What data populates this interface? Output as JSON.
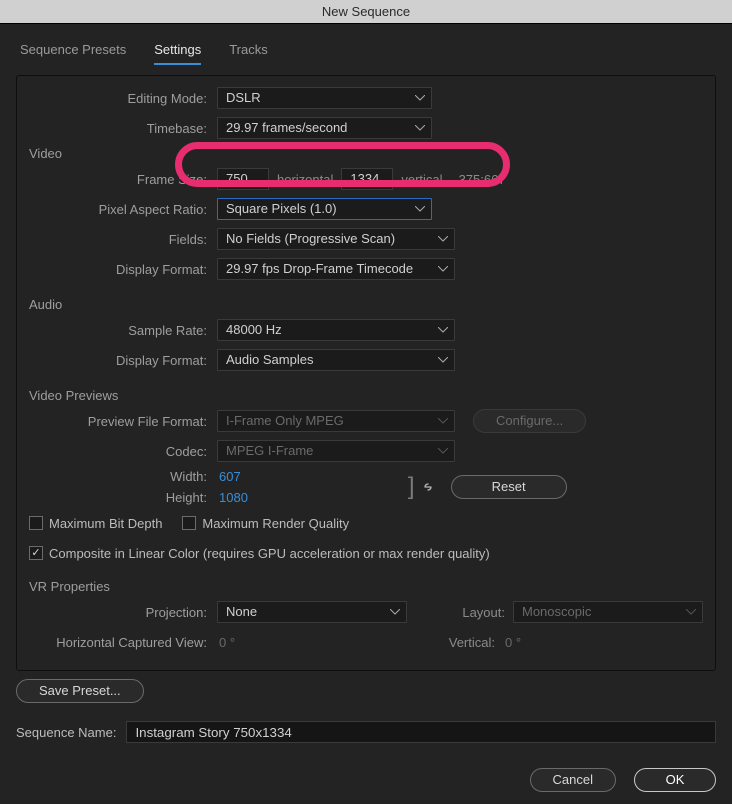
{
  "title": "New Sequence",
  "tabs": {
    "presets": "Sequence Presets",
    "settings": "Settings",
    "tracks": "Tracks"
  },
  "main": {
    "editing_mode_label": "Editing Mode:",
    "editing_mode_value": "DSLR",
    "timebase_label": "Timebase:",
    "timebase_value": "29.97  frames/second"
  },
  "video": {
    "section": "Video",
    "frame_size_label": "Frame Size:",
    "horiz_value": "750",
    "horiz_label": "horizontal",
    "vert_value": "1334",
    "vert_label": "vertical",
    "aspect": "375:667",
    "par_label": "Pixel Aspect Ratio:",
    "par_value": "Square Pixels (1.0)",
    "fields_label": "Fields:",
    "fields_value": "No Fields (Progressive Scan)",
    "dispfmt_label": "Display Format:",
    "dispfmt_value": "29.97 fps Drop-Frame Timecode"
  },
  "audio": {
    "section": "Audio",
    "sample_rate_label": "Sample Rate:",
    "sample_rate_value": "48000 Hz",
    "dispfmt_label": "Display Format:",
    "dispfmt_value": "Audio Samples"
  },
  "previews": {
    "section": "Video Previews",
    "fileformat_label": "Preview File Format:",
    "fileformat_value": "I-Frame Only MPEG",
    "configure_label": "Configure...",
    "codec_label": "Codec:",
    "codec_value": "MPEG I-Frame",
    "width_label": "Width:",
    "width_value": "607",
    "height_label": "Height:",
    "height_value": "1080",
    "reset_label": "Reset",
    "max_bit_depth": "Maximum Bit Depth",
    "max_render_quality": "Maximum Render Quality",
    "composite_linear": "Composite in Linear Color (requires GPU acceleration or max render quality)"
  },
  "vr": {
    "section": "VR Properties",
    "projection_label": "Projection:",
    "projection_value": "None",
    "layout_label": "Layout:",
    "layout_value": "Monoscopic",
    "hcaptured_label": "Horizontal Captured View:",
    "hcaptured_value": "0 °",
    "vcaptured_label": "Vertical:",
    "vcaptured_value": "0 °"
  },
  "save_preset": "Save Preset...",
  "seq_name_label": "Sequence Name:",
  "seq_name_value": "Instagram Story 750x1334",
  "cancel": "Cancel",
  "ok": "OK"
}
